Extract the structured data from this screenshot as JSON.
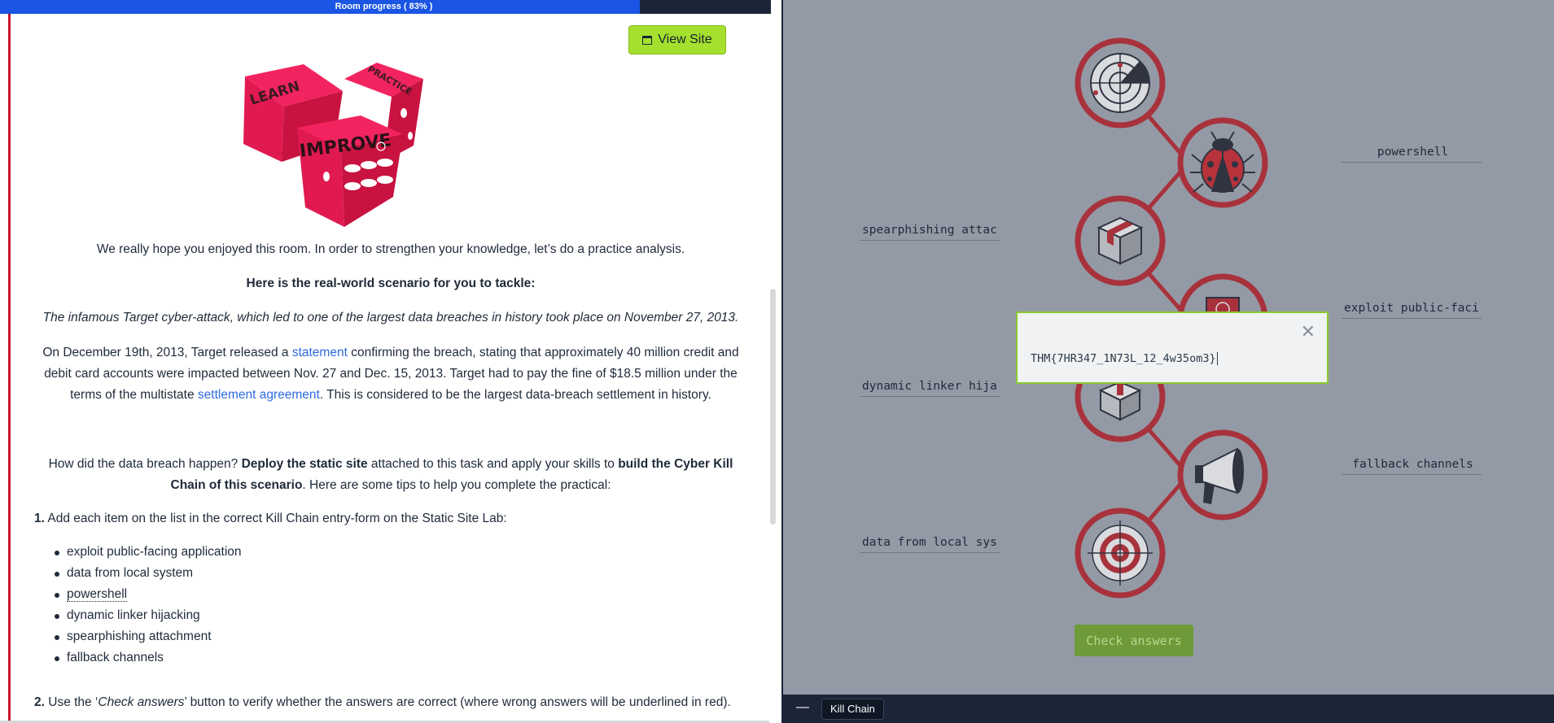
{
  "room": {
    "progress_label": "Room progress ( 83% )",
    "progress_fraction": 0.83
  },
  "left": {
    "view_site_label": "View Site",
    "dice_words": [
      "LEARN",
      "PRACTICE",
      "IMPROVE"
    ],
    "intro": "We really hope you enjoyed this room. In order to strengthen your knowledge, let’s do a practice analysis.",
    "scenario_heading": "Here is the real-world scenario for you to tackle:",
    "scenario_italic": "The infamous Target cyber-attack, which led to one of the largest data breaches in history took place on November 27, 2013.",
    "breach_p1": "On December 19th, 2013, Target released a ",
    "breach_link1": "statement",
    "breach_p2": " confirming the breach, stating that approximately 40 million credit and debit card accounts were impacted between Nov. 27 and Dec. 15, 2013. Target had to pay the fine of $18.5 million under the terms of the multistate ",
    "breach_link2": "settlement agreement",
    "breach_p3": ". This is considered to be the largest data-breach settlement in history.",
    "how_p1": "How did the data breach happen? ",
    "how_b1": "Deploy the static site",
    "how_p2": " attached to this task and apply your skills to ",
    "how_b2": "build the Cyber Kill Chain of this scenario",
    "how_p3": ". Here are some tips to help you complete the practical:",
    "step1_num": "1.",
    "step1_text": " Add each item on the list in the correct Kill Chain entry-form on the Static Site Lab:",
    "items": [
      "exploit public-facing application",
      "data from local system",
      "powershell",
      "dynamic linker hijacking",
      "spearphishing attachment",
      "fallback channels"
    ],
    "step2_num": "2.",
    "step2_a": " Use the ‘",
    "step2_italic": "Check answers",
    "step2_b": "’ button to verify whether the answers are correct (where wrong answers will be underlined in red)."
  },
  "right": {
    "slots": {
      "powershell": "powershell",
      "spearphishing": "spearphishing attac",
      "exploit": "exploit public-faci",
      "dynamic": "dynamic linker hija",
      "fallback": "fallback channels",
      "data_local": "data from local sys"
    },
    "chain_icons": [
      "radar-icon",
      "ladybug-icon",
      "package-icon",
      "exploit-icon",
      "open-box-icon",
      "megaphone-icon",
      "target-icon"
    ],
    "popup_flag": "THM{7HR347_1N73L_12_4w35om3}",
    "close_symbol": "✕",
    "check_answers_label": "Check answers",
    "taskbar_min": "—",
    "taskbar_tab": "Kill Chain"
  },
  "colors": {
    "progress_blue": "#1a55e3",
    "accent_red": "#c8102e",
    "view_site_green": "#a5e02f",
    "chain_red": "#a8323c",
    "panel_gray": "#939aa5",
    "check_green": "#6e9a3a"
  }
}
